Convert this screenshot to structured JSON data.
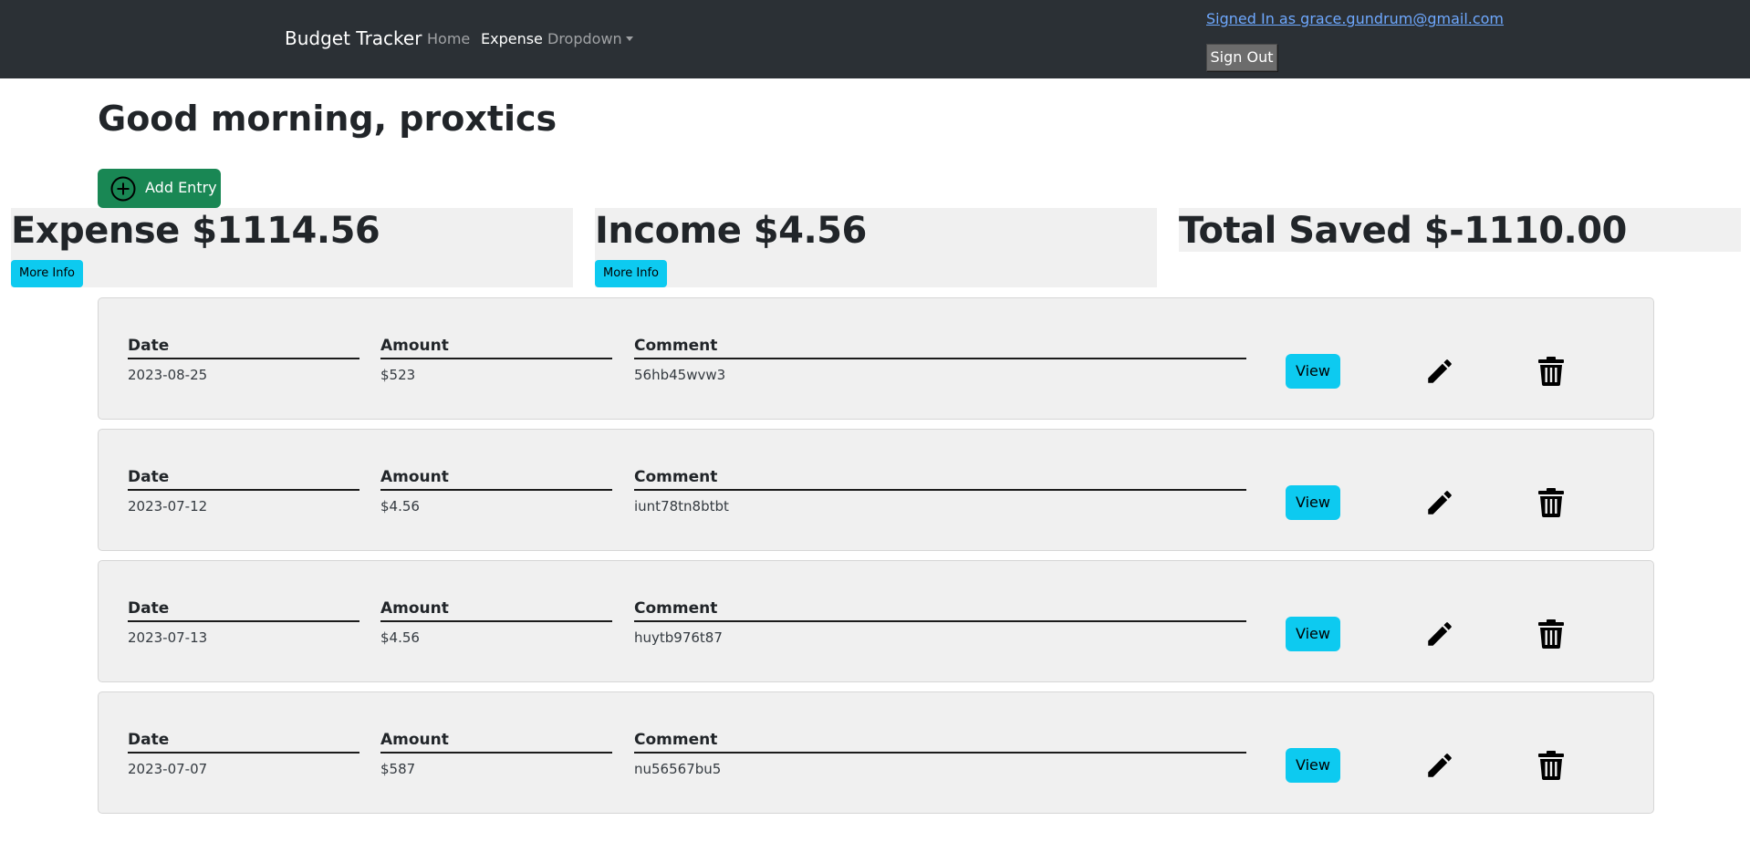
{
  "navbar": {
    "brand": "Budget Tracker",
    "links": [
      "Home",
      "Expense",
      "Dropdown"
    ],
    "signed_in": "Signed In as grace.gundrum@gmail.com",
    "sign_out": "Sign Out"
  },
  "greeting": "Good morning, proxtics",
  "add_entry": "Add Entry",
  "summary": {
    "expense": "Expense $1114.56",
    "income": "Income $4.56",
    "total": "Total Saved $-1110.00",
    "more_info": "More Info"
  },
  "columns": {
    "date": "Date",
    "amount": "Amount",
    "comment": "Comment"
  },
  "entries": [
    {
      "date": "2023-08-25",
      "amount": "$523",
      "comment": "56hb45wvw3",
      "view": "View"
    },
    {
      "date": "2023-07-12",
      "amount": "$4.56",
      "comment": "iunt78tn8btbt",
      "view": "View"
    },
    {
      "date": "2023-07-13",
      "amount": "$4.56",
      "comment": "huytb976t87",
      "view": "View"
    },
    {
      "date": "2023-07-07",
      "amount": "$587",
      "comment": "nu56567bu5",
      "view": "View"
    }
  ],
  "icons": {
    "add": "plus-circle-icon",
    "edit": "pencil-icon",
    "delete": "trash-icon"
  },
  "colors": {
    "navbar": "#2b3035",
    "success": "#198754",
    "info": "#0dcaf0",
    "panel": "#f0f0f0",
    "link": "#6ea8fe"
  }
}
